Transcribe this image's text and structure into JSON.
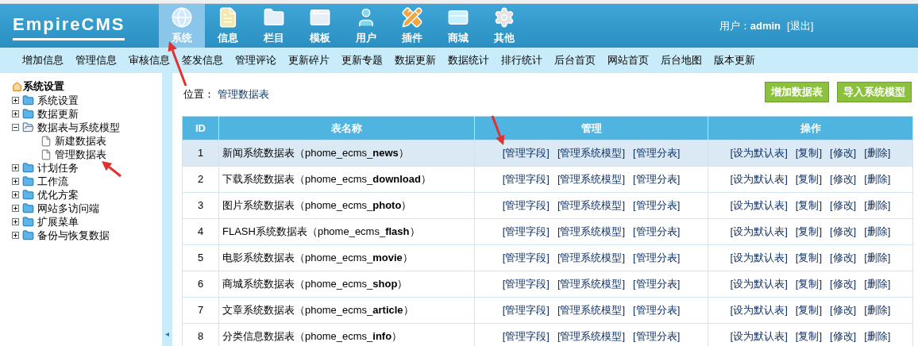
{
  "logo": {
    "text": "EmpireCMS"
  },
  "main_tabs": [
    {
      "label": "系统",
      "selected": true
    },
    {
      "label": "信息",
      "selected": false
    },
    {
      "label": "栏目",
      "selected": false
    },
    {
      "label": "模板",
      "selected": false
    },
    {
      "label": "用户",
      "selected": false
    },
    {
      "label": "插件",
      "selected": false
    },
    {
      "label": "商城",
      "selected": false
    },
    {
      "label": "其他",
      "selected": false
    }
  ],
  "user": {
    "label": "用户：",
    "name": "admin",
    "logout": "[退出]"
  },
  "sub_nav": [
    "增加信息",
    "管理信息",
    "审核信息",
    "签发信息",
    "管理评论",
    "更新碎片",
    "更新专题",
    "数据更新",
    "数据统计",
    "排行统计",
    "后台首页",
    "网站首页",
    "后台地图",
    "版本更新"
  ],
  "tree": {
    "title": "系统设置",
    "items": [
      {
        "label": "系统设置",
        "expanded": false
      },
      {
        "label": "数据更新",
        "expanded": false
      },
      {
        "label": "数据表与系统模型",
        "expanded": true,
        "children": [
          {
            "label": "新建数据表"
          },
          {
            "label": "管理数据表"
          }
        ]
      },
      {
        "label": "计划任务",
        "expanded": false
      },
      {
        "label": "工作流",
        "expanded": false
      },
      {
        "label": "优化方案",
        "expanded": false
      },
      {
        "label": "网站多访问端",
        "expanded": false
      },
      {
        "label": "扩展菜单",
        "expanded": false
      },
      {
        "label": "备份与恢复数据",
        "expanded": false
      }
    ]
  },
  "breadcrumb": {
    "label": "位置：",
    "current": "管理数据表"
  },
  "actions": [
    "增加数据表",
    "导入系统模型"
  ],
  "table": {
    "columns": [
      "ID",
      "表名称",
      "管理",
      "操作"
    ],
    "rows": [
      {
        "id": "1",
        "name": "新闻系统数据表（phome_ecms_**news**）",
        "selected": true,
        "manage": [
          "[管理字段]",
          "[管理系统模型]",
          "[管理分表]"
        ],
        "operations": [
          "[设为默认表]",
          "[复制]",
          "[修改]",
          "[删除]"
        ]
      },
      {
        "id": "2",
        "name": "下载系统数据表（phome_ecms_**download**）",
        "selected": false,
        "manage": [
          "[管理字段]",
          "[管理系统模型]",
          "[管理分表]"
        ],
        "operations": [
          "[设为默认表]",
          "[复制]",
          "[修改]",
          "[删除]"
        ]
      },
      {
        "id": "3",
        "name": "图片系统数据表（phome_ecms_**photo**）",
        "selected": false,
        "manage": [
          "[管理字段]",
          "[管理系统模型]",
          "[管理分表]"
        ],
        "operations": [
          "[设为默认表]",
          "[复制]",
          "[修改]",
          "[删除]"
        ]
      },
      {
        "id": "4",
        "name": "FLASH系统数据表（phome_ecms_**flash**）",
        "selected": false,
        "manage": [
          "[管理字段]",
          "[管理系统模型]",
          "[管理分表]"
        ],
        "operations": [
          "[设为默认表]",
          "[复制]",
          "[修改]",
          "[删除]"
        ]
      },
      {
        "id": "5",
        "name": "电影系统数据表（phome_ecms_**movie**）",
        "selected": false,
        "manage": [
          "[管理字段]",
          "[管理系统模型]",
          "[管理分表]"
        ],
        "operations": [
          "[设为默认表]",
          "[复制]",
          "[修改]",
          "[删除]"
        ]
      },
      {
        "id": "6",
        "name": "商城系统数据表（phome_ecms_**shop**）",
        "selected": false,
        "manage": [
          "[管理字段]",
          "[管理系统模型]",
          "[管理分表]"
        ],
        "operations": [
          "[设为默认表]",
          "[复制]",
          "[修改]",
          "[删除]"
        ]
      },
      {
        "id": "7",
        "name": "文章系统数据表（phome_ecms_**article**）",
        "selected": false,
        "manage": [
          "[管理字段]",
          "[管理系统模型]",
          "[管理分表]"
        ],
        "operations": [
          "[设为默认表]",
          "[复制]",
          "[修改]",
          "[删除]"
        ]
      },
      {
        "id": "8",
        "name": "分类信息数据表（phome_ecms_**info**）",
        "selected": false,
        "manage": [
          "[管理字段]",
          "[管理系统模型]",
          "[管理分表]"
        ],
        "operations": [
          "[设为默认表]",
          "[复制]",
          "[修改]",
          "[删除]"
        ]
      }
    ]
  },
  "collapse_toggle": "◂"
}
